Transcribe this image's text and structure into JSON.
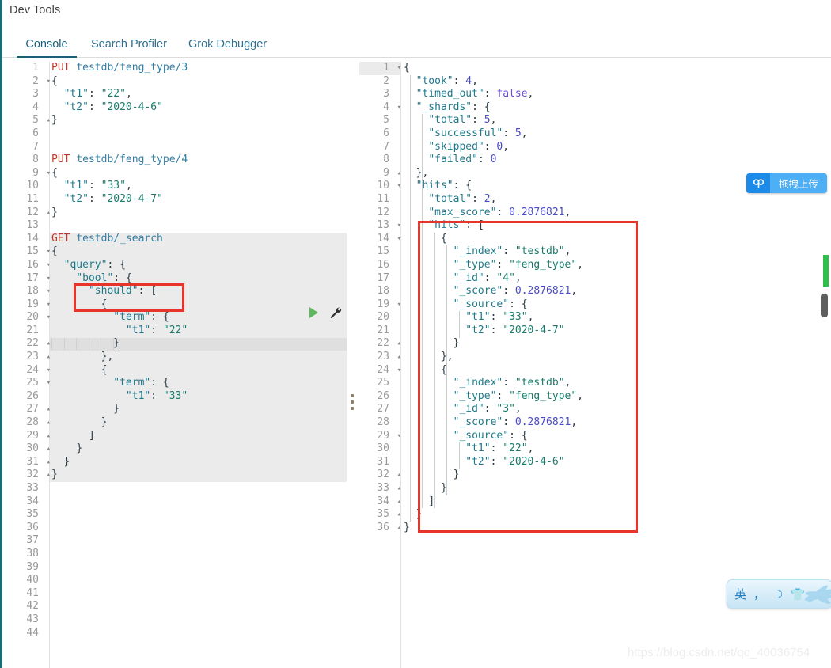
{
  "app": {
    "title": "Dev Tools",
    "watermark": "https://blog.csdn.net/qq_40036754"
  },
  "tabs": [
    {
      "id": "console",
      "label": "Console",
      "active": true
    },
    {
      "id": "search-profiler",
      "label": "Search Profiler",
      "active": false
    },
    {
      "id": "grok-debugger",
      "label": "Grok Debugger",
      "active": false
    }
  ],
  "toolbar": {
    "run_label": "▶",
    "wrench_label": "wrench"
  },
  "editor": {
    "total_line_numbers": 44,
    "active_line": 22,
    "request_highlight_start_line": 14,
    "request_highlight_end_line": 32,
    "lines": [
      {
        "n": 1,
        "fold": "",
        "text": "PUT testdb/feng_type/3"
      },
      {
        "n": 2,
        "fold": "▾",
        "text": "{"
      },
      {
        "n": 3,
        "fold": "",
        "text": "  \"t1\": \"22\","
      },
      {
        "n": 4,
        "fold": "",
        "text": "  \"t2\": \"2020-4-6\""
      },
      {
        "n": 5,
        "fold": "▴",
        "text": "}"
      },
      {
        "n": 6,
        "fold": "",
        "text": ""
      },
      {
        "n": 7,
        "fold": "",
        "text": ""
      },
      {
        "n": 8,
        "fold": "",
        "text": "PUT testdb/feng_type/4"
      },
      {
        "n": 9,
        "fold": "▾",
        "text": "{"
      },
      {
        "n": 10,
        "fold": "",
        "text": "  \"t1\": \"33\","
      },
      {
        "n": 11,
        "fold": "",
        "text": "  \"t2\": \"2020-4-7\""
      },
      {
        "n": 12,
        "fold": "▴",
        "text": "}"
      },
      {
        "n": 13,
        "fold": "",
        "text": ""
      },
      {
        "n": 14,
        "fold": "",
        "text": "GET testdb/_search"
      },
      {
        "n": 15,
        "fold": "▾",
        "text": "{"
      },
      {
        "n": 16,
        "fold": "▾",
        "text": "  \"query\": {"
      },
      {
        "n": 17,
        "fold": "▾",
        "text": "    \"bool\": {"
      },
      {
        "n": 18,
        "fold": "▾",
        "text": "      \"should\": ["
      },
      {
        "n": 19,
        "fold": "▾",
        "text": "        {"
      },
      {
        "n": 20,
        "fold": "▾",
        "text": "          \"term\": {"
      },
      {
        "n": 21,
        "fold": "",
        "text": "            \"t1\": \"22\""
      },
      {
        "n": 22,
        "fold": "▴",
        "text": "          }"
      },
      {
        "n": 23,
        "fold": "▴",
        "text": "        },"
      },
      {
        "n": 24,
        "fold": "▾",
        "text": "        {"
      },
      {
        "n": 25,
        "fold": "▾",
        "text": "          \"term\": {"
      },
      {
        "n": 26,
        "fold": "",
        "text": "            \"t1\": \"33\""
      },
      {
        "n": 27,
        "fold": "▴",
        "text": "          }"
      },
      {
        "n": 28,
        "fold": "▴",
        "text": "        }"
      },
      {
        "n": 29,
        "fold": "▴",
        "text": "      ]"
      },
      {
        "n": 30,
        "fold": "▴",
        "text": "    }"
      },
      {
        "n": 31,
        "fold": "▴",
        "text": "  }"
      },
      {
        "n": 32,
        "fold": "▴",
        "text": "}"
      },
      {
        "n": 33,
        "fold": "",
        "text": ""
      },
      {
        "n": 34,
        "fold": "",
        "text": ""
      },
      {
        "n": 35,
        "fold": "",
        "text": ""
      },
      {
        "n": 36,
        "fold": "",
        "text": ""
      },
      {
        "n": 37,
        "fold": "",
        "text": ""
      },
      {
        "n": 38,
        "fold": "",
        "text": ""
      },
      {
        "n": 39,
        "fold": "",
        "text": ""
      },
      {
        "n": 40,
        "fold": "",
        "text": ""
      },
      {
        "n": 41,
        "fold": "",
        "text": ""
      },
      {
        "n": 42,
        "fold": "",
        "text": ""
      },
      {
        "n": 43,
        "fold": "",
        "text": ""
      },
      {
        "n": 44,
        "fold": "",
        "text": ""
      }
    ]
  },
  "response": {
    "lines": [
      {
        "n": 1,
        "fold": "▾",
        "text": "{"
      },
      {
        "n": 2,
        "fold": "",
        "text": "  \"took\": 4,"
      },
      {
        "n": 3,
        "fold": "",
        "text": "  \"timed_out\": false,"
      },
      {
        "n": 4,
        "fold": "▾",
        "text": "  \"_shards\": {"
      },
      {
        "n": 5,
        "fold": "",
        "text": "    \"total\": 5,"
      },
      {
        "n": 6,
        "fold": "",
        "text": "    \"successful\": 5,"
      },
      {
        "n": 7,
        "fold": "",
        "text": "    \"skipped\": 0,"
      },
      {
        "n": 8,
        "fold": "",
        "text": "    \"failed\": 0"
      },
      {
        "n": 9,
        "fold": "▴",
        "text": "  },"
      },
      {
        "n": 10,
        "fold": "▾",
        "text": "  \"hits\": {"
      },
      {
        "n": 11,
        "fold": "",
        "text": "    \"total\": 2,"
      },
      {
        "n": 12,
        "fold": "",
        "text": "    \"max_score\": 0.2876821,"
      },
      {
        "n": 13,
        "fold": "▾",
        "text": "    \"hits\": ["
      },
      {
        "n": 14,
        "fold": "▾",
        "text": "      {"
      },
      {
        "n": 15,
        "fold": "",
        "text": "        \"_index\": \"testdb\","
      },
      {
        "n": 16,
        "fold": "",
        "text": "        \"_type\": \"feng_type\","
      },
      {
        "n": 17,
        "fold": "",
        "text": "        \"_id\": \"4\","
      },
      {
        "n": 18,
        "fold": "",
        "text": "        \"_score\": 0.2876821,"
      },
      {
        "n": 19,
        "fold": "▾",
        "text": "        \"_source\": {"
      },
      {
        "n": 20,
        "fold": "",
        "text": "          \"t1\": \"33\","
      },
      {
        "n": 21,
        "fold": "",
        "text": "          \"t2\": \"2020-4-7\""
      },
      {
        "n": 22,
        "fold": "▴",
        "text": "        }"
      },
      {
        "n": 23,
        "fold": "▴",
        "text": "      },"
      },
      {
        "n": 24,
        "fold": "▾",
        "text": "      {"
      },
      {
        "n": 25,
        "fold": "",
        "text": "        \"_index\": \"testdb\","
      },
      {
        "n": 26,
        "fold": "",
        "text": "        \"_type\": \"feng_type\","
      },
      {
        "n": 27,
        "fold": "",
        "text": "        \"_id\": \"3\","
      },
      {
        "n": 28,
        "fold": "",
        "text": "        \"_score\": 0.2876821,"
      },
      {
        "n": 29,
        "fold": "▾",
        "text": "        \"_source\": {"
      },
      {
        "n": 30,
        "fold": "",
        "text": "          \"t1\": \"22\","
      },
      {
        "n": 31,
        "fold": "",
        "text": "          \"t2\": \"2020-4-6\""
      },
      {
        "n": 32,
        "fold": "▴",
        "text": "        }"
      },
      {
        "n": 33,
        "fold": "▴",
        "text": "      }"
      },
      {
        "n": 34,
        "fold": "▴",
        "text": "    ]"
      },
      {
        "n": 35,
        "fold": "▴",
        "text": "  }"
      },
      {
        "n": 36,
        "fold": "▴",
        "text": "}"
      }
    ]
  },
  "annotations": {
    "left_box_target": "\"bool\": { / \"should\": [",
    "right_box_target": "hits array",
    "color": "#e8352b"
  },
  "widgets": {
    "upload": {
      "label": "拖拽上传",
      "icon": "cloud-upload-icon",
      "bg": "#4aa8f5"
    },
    "ime": {
      "items": [
        "英",
        "，",
        "☽",
        "👕"
      ],
      "bg": "#d6ecf8"
    }
  }
}
